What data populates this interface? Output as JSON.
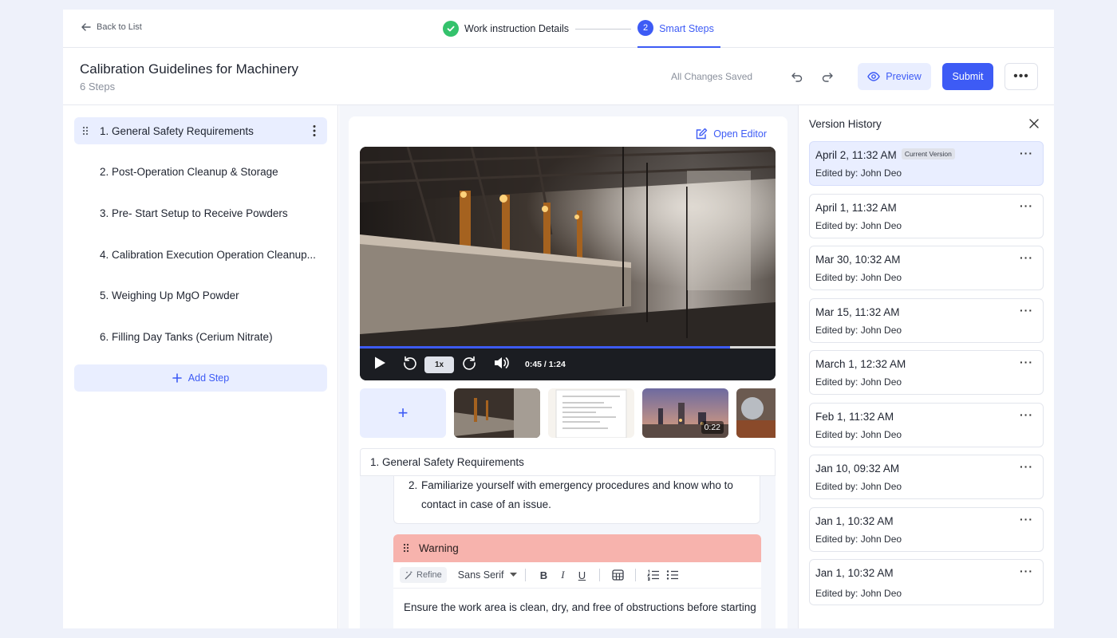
{
  "topbar": {
    "back_label": "Back to List",
    "steps": [
      {
        "label": "Work instruction Details",
        "status": "complete"
      },
      {
        "label": "Smart Steps",
        "number": "2",
        "status": "active"
      }
    ]
  },
  "header": {
    "title": "Calibration Guidelines for Machinery",
    "subtitle": "6 Steps",
    "saved_status": "All Changes Saved",
    "preview_label": "Preview",
    "submit_label": "Submit"
  },
  "steps_list": {
    "items": [
      {
        "label": "1. General Safety Requirements",
        "active": true
      },
      {
        "label": "2. Post-Operation Cleanup & Storage"
      },
      {
        "label": "3. Pre- Start Setup to Receive Powders"
      },
      {
        "label": "4. Calibration Execution Operation Cleanup..."
      },
      {
        "label": "5. Weighing Up MgO Powder"
      },
      {
        "label": "6. Filling Day Tanks (Cerium Nitrate)"
      }
    ],
    "add_label": "Add Step"
  },
  "editor": {
    "open_editor_label": "Open Editor",
    "video": {
      "speed": "1x",
      "time": "0:45 / 1:24",
      "progress": 0.89
    },
    "thumb_duration": "0:22",
    "step_title": "1. General Safety Requirements",
    "list_number": "2.",
    "list_text": "Familiarize yourself with emergency procedures and know who to contact in case of an issue.",
    "warning_title": "Warning",
    "toolbar": {
      "refine": "Refine",
      "font": "Sans Serif"
    },
    "warning_text": "Ensure the work area is clean, dry, and free of obstructions before starting"
  },
  "version_history": {
    "title": "Version History",
    "current_badge": "Current Version",
    "versions": [
      {
        "date": "April 2, 11:32 AM",
        "editor": "Edited by: John Deo",
        "current": true
      },
      {
        "date": "April 1, 11:32 AM",
        "editor": "Edited by: John Deo"
      },
      {
        "date": "Mar 30, 10:32 AM",
        "editor": "Edited by: John Deo"
      },
      {
        "date": "Mar 15, 11:32 AM",
        "editor": "Edited by: John Deo"
      },
      {
        "date": "March 1, 12:32 AM",
        "editor": "Edited by: John Deo"
      },
      {
        "date": "Feb 1, 11:32 AM",
        "editor": "Edited by: John Deo"
      },
      {
        "date": "Jan 10, 09:32 AM",
        "editor": "Edited by: John Deo"
      },
      {
        "date": "Jan 1, 10:32 AM",
        "editor": "Edited by: John Deo"
      },
      {
        "date": "Jan 1, 10:32 AM",
        "editor": "Edited by: John Deo"
      }
    ]
  },
  "colors": {
    "accent": "#3d5bf5",
    "success": "#34c26c",
    "warning": "#f7b3ad",
    "active_bg": "#e9eeff"
  },
  "icons": [
    "arrow-left-icon",
    "check-icon",
    "undo-icon",
    "redo-icon",
    "eye-icon",
    "more-icon",
    "drag-icon",
    "kebab-icon",
    "plus-icon",
    "edit-icon",
    "play-icon",
    "replay-icon",
    "forward-icon",
    "volume-icon",
    "close-icon",
    "refine-icon",
    "bold-icon",
    "italic-icon",
    "underline-icon",
    "table-icon",
    "ordered-list-icon",
    "bullet-list-icon"
  ]
}
